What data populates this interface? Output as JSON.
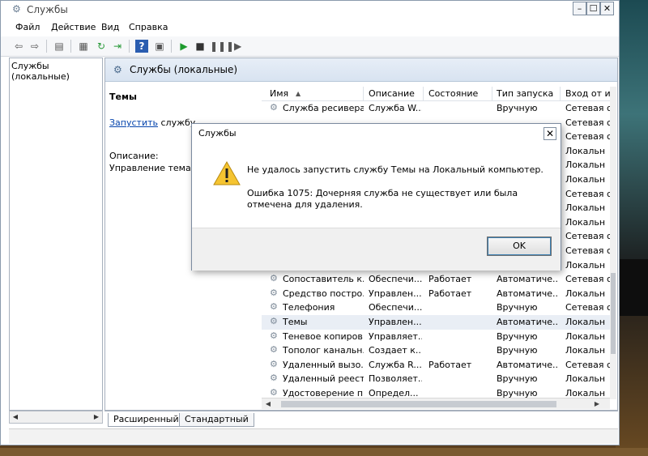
{
  "window": {
    "title": "Службы",
    "title_icon": "gear-icon"
  },
  "menu": [
    "Файл",
    "Действие",
    "Вид",
    "Справка"
  ],
  "toolbar_icons": [
    "back-arrow-icon",
    "forward-arrow-icon",
    "console-tree-icon",
    "properties-icon",
    "refresh-icon",
    "export-list-icon",
    "help-icon",
    "show-hide-icon",
    "play-icon",
    "stop-icon",
    "pause-icon",
    "restart-icon"
  ],
  "left_tree": {
    "item": "Службы (локальные)"
  },
  "pane_header": "Службы (локальные)",
  "description": {
    "title": "Темы",
    "start_link": "Запустить",
    "start_suffix": " службу",
    "label": "Описание:",
    "text": "Управление темами"
  },
  "columns": [
    "Имя",
    "Описание",
    "Состояние",
    "Тип запуска",
    "Вход от и"
  ],
  "rows": [
    {
      "name": "Служба ресивера...",
      "desc": "Служба W...",
      "state": "",
      "startup": "Вручную",
      "logon": "Сетевая с"
    },
    {
      "name": "",
      "desc": "",
      "state": "",
      "startup": "",
      "logon": "Сетевая с"
    },
    {
      "name": "",
      "desc": "",
      "state": "",
      "startup": "",
      "logon": "Сетевая с"
    },
    {
      "name": "",
      "desc": "",
      "state": "",
      "startup": "",
      "logon": "Локальн"
    },
    {
      "name": "",
      "desc": "",
      "state": "",
      "startup": "",
      "logon": "Локальн"
    },
    {
      "name": "",
      "desc": "",
      "state": "",
      "startup": "",
      "logon": "Локальн"
    },
    {
      "name": "",
      "desc": "",
      "state": "",
      "startup": "",
      "logon": "Сетевая с"
    },
    {
      "name": "",
      "desc": "",
      "state": "",
      "startup": "",
      "logon": "Локальн"
    },
    {
      "name": "",
      "desc": "",
      "state": "",
      "startup": "",
      "logon": "Локальн"
    },
    {
      "name": "",
      "desc": "",
      "state": "",
      "startup": "",
      "logon": "Сетевая с"
    },
    {
      "name": "",
      "desc": "",
      "state": "",
      "startup": "",
      "logon": "Сетевая с"
    },
    {
      "name": "",
      "desc": "",
      "state": "",
      "startup": "",
      "logon": "Локальн"
    },
    {
      "name": "Сопоставитель к...",
      "desc": "Обеспечи...",
      "state": "Работает",
      "startup": "Автоматиче...",
      "logon": "Сетевая с"
    },
    {
      "name": "Средство постро...",
      "desc": "Управлен...",
      "state": "Работает",
      "startup": "Автоматиче...",
      "logon": "Локальн"
    },
    {
      "name": "Телефония",
      "desc": "Обеспечи...",
      "state": "",
      "startup": "Вручную",
      "logon": "Сетевая с"
    },
    {
      "name": "Темы",
      "desc": "Управлен...",
      "state": "",
      "startup": "Автоматиче...",
      "logon": "Локальн",
      "selected": true
    },
    {
      "name": "Теневое копиров...",
      "desc": "Управляет...",
      "state": "",
      "startup": "Вручную",
      "logon": "Локальн"
    },
    {
      "name": "Тополог канальн...",
      "desc": "Создает к...",
      "state": "",
      "startup": "Вручную",
      "logon": "Локальн"
    },
    {
      "name": "Удаленный вызо...",
      "desc": "Служба R...",
      "state": "Работает",
      "startup": "Автоматиче...",
      "logon": "Сетевая с"
    },
    {
      "name": "Удаленный реестр",
      "desc": "Позволяет...",
      "state": "",
      "startup": "Вручную",
      "logon": "Локальн"
    },
    {
      "name": "Удостоверение п...",
      "desc": "Определ...",
      "state": "",
      "startup": "Вручную",
      "logon": "Локальн"
    }
  ],
  "tabs": [
    "Расширенный",
    "Стандартный"
  ],
  "dialog": {
    "title": "Службы",
    "message": "Не удалось запустить службу Темы на Локальный компьютер.",
    "error": "Ошибка 1075: Дочерняя служба не существует или была отмечена для удаления.",
    "ok_label": "OK",
    "icon": "warning-icon"
  }
}
